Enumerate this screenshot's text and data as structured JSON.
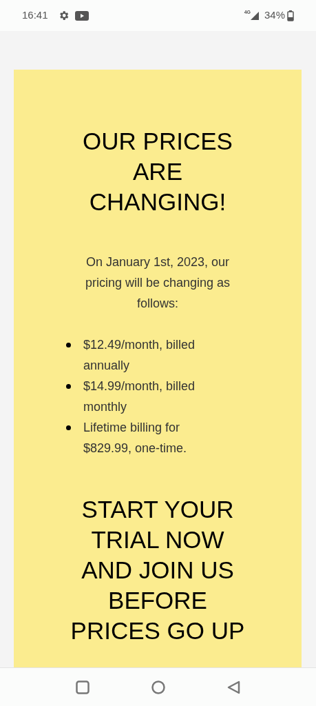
{
  "status_bar": {
    "time": "16:41",
    "network": "4G",
    "battery": "34%"
  },
  "notice": {
    "title": "OUR PRICES ARE CHANGING!",
    "intro": "On January 1st, 2023, our pricing will be changing as follows:",
    "items": [
      "$12.49/month, billed annually",
      "$14.99/month, billed monthly",
      "Lifetime billing for $829.99, one-time."
    ],
    "cta": "START YOUR TRIAL NOW AND JOIN US BEFORE PRICES GO UP"
  }
}
